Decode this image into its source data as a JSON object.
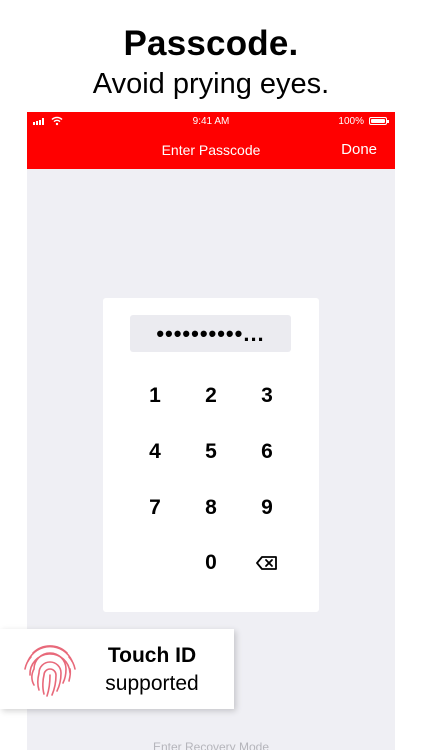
{
  "promo": {
    "headline": "Passcode.",
    "subline": "Avoid prying eyes."
  },
  "status_bar": {
    "signal_icon": "signal-bars-icon",
    "wifi_icon": "wifi-icon",
    "time": "9:41 AM",
    "battery_percent": "100%",
    "battery_level": 1.0,
    "battery_icon": "battery-icon"
  },
  "nav_bar": {
    "title": "Enter Passcode",
    "done_label": "Done"
  },
  "passcode_field": {
    "value": "••••••••••..."
  },
  "keypad": {
    "keys": [
      "1",
      "2",
      "3",
      "4",
      "5",
      "6",
      "7",
      "8",
      "9",
      "0"
    ],
    "delete_icon": "backspace-icon"
  },
  "touch_id": {
    "title": "Touch ID",
    "subtitle": "supported",
    "icon": "fingerprint-icon"
  },
  "recovery": {
    "label": "Enter Recovery Mode"
  },
  "colors": {
    "accent": "#ff0000",
    "background": "#efeff4",
    "fingerprint": "#e8697a"
  }
}
